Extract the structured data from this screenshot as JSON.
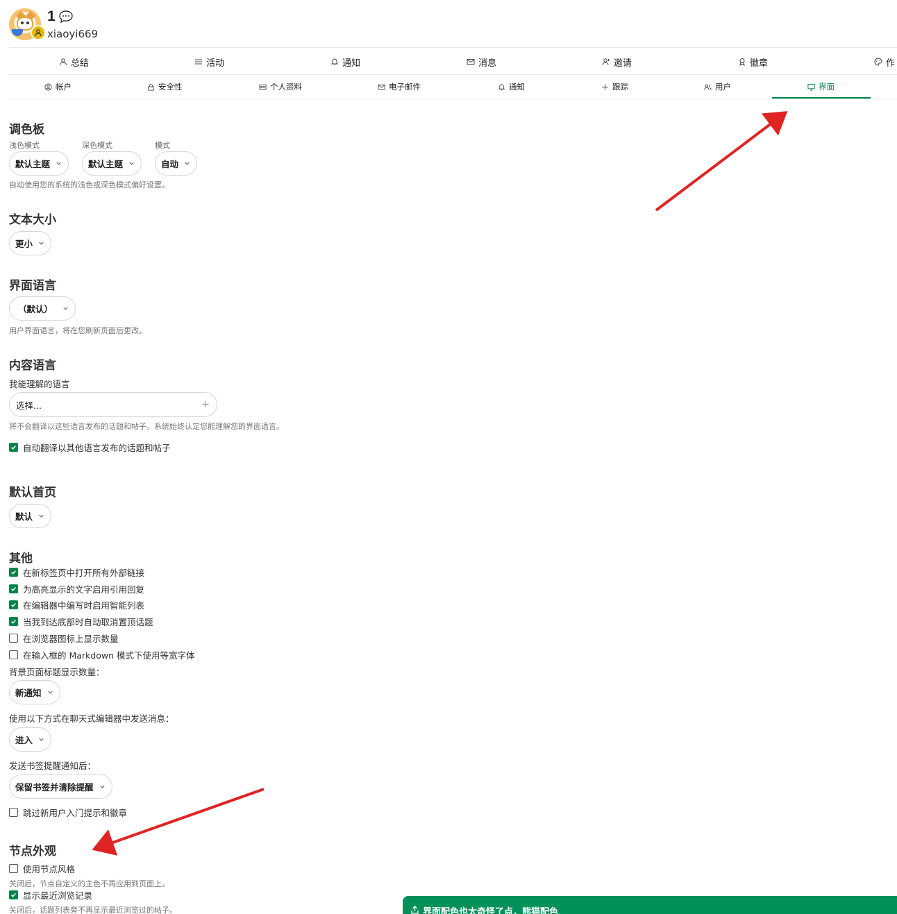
{
  "user": {
    "display_name": "1",
    "username": "xiaoyi669"
  },
  "nav_primary": [
    {
      "label": "总结",
      "icon": "user-icon"
    },
    {
      "label": "活动",
      "icon": "list-icon"
    },
    {
      "label": "通知",
      "icon": "bell-icon"
    },
    {
      "label": "消息",
      "icon": "envelope-icon"
    },
    {
      "label": "邀请",
      "icon": "user-plus-icon"
    },
    {
      "label": "徽章",
      "icon": "badge-icon"
    },
    {
      "label": "作",
      "icon": "palette-icon"
    }
  ],
  "nav_secondary": [
    {
      "label": "帐户",
      "icon": "user-circle-icon"
    },
    {
      "label": "安全性",
      "icon": "lock-icon"
    },
    {
      "label": "个人资料",
      "icon": "id-card-icon"
    },
    {
      "label": "电子邮件",
      "icon": "envelope-icon"
    },
    {
      "label": "通知",
      "icon": "bell-icon"
    },
    {
      "label": "跟踪",
      "icon": "plus-icon"
    },
    {
      "label": "用户",
      "icon": "users-icon"
    },
    {
      "label": "界面",
      "icon": "desktop-icon",
      "active": true
    }
  ],
  "palette": {
    "title": "调色板",
    "light_label": "浅色模式",
    "light_value": "默认主题",
    "dark_label": "深色模式",
    "dark_value": "默认主题",
    "mode_label": "模式",
    "mode_value": "自动",
    "hint": "自动使用您的系统的浅色或深色模式偏好设置。"
  },
  "text_size": {
    "title": "文本大小",
    "value": "更小"
  },
  "ui_language": {
    "title": "界面语言",
    "value": "（默认）",
    "hint": "用户界面语言，将在您刷新页面后更改。"
  },
  "content_language": {
    "title": "内容语言",
    "label": "我能理解的语言",
    "placeholder": "选择...",
    "plus": "+",
    "hint": "将不会翻译以这些语言发布的话题和帖子。系统始终认定您能理解您的界面语言。",
    "auto_translate": "自动翻译以其他语言发布的话题和帖子"
  },
  "homepage": {
    "title": "默认首页",
    "value": "默认"
  },
  "other": {
    "title": "其他",
    "checks": [
      {
        "label": "在新标签页中打开所有外部链接",
        "checked": true
      },
      {
        "label": "为高亮显示的文字启用引用回复",
        "checked": true
      },
      {
        "label": "在编辑器中编写时启用智能列表",
        "checked": true
      },
      {
        "label": "当我到达底部时自动取消置顶话题",
        "checked": true
      },
      {
        "label": "在浏览器图标上显示数量",
        "checked": false
      },
      {
        "label": "在输入框的 Markdown 模式下使用等宽字体",
        "checked": false
      }
    ],
    "bg_title_label": "背景页面标题显示数量：",
    "bg_title_value": "新通知",
    "chat_send_label": "使用以下方式在聊天式编辑器中发送消息：",
    "chat_send_value": "进入",
    "bookmark_label": "发送书签提醒通知后：",
    "bookmark_value": "保留书签并清除提醒",
    "skip_onboarding": "跳过新用户入门提示和徽章"
  },
  "node_appearance": {
    "title": "节点外观",
    "use_node_style": "使用节点风格",
    "use_node_style_hint": "关闭后，节点自定义的主色不再应用到页面上。",
    "show_recent": "显示最近浏览记录",
    "show_recent_hint": "关闭后，话题列表旁不再显示最近浏览过的帖子。"
  },
  "toast": {
    "text": "界面配色也太奇怪了点，熊猫配色"
  },
  "colors": {
    "accent": "#00844a",
    "annotation_arrow": "#e02424",
    "toast_bg": "#00905a"
  }
}
